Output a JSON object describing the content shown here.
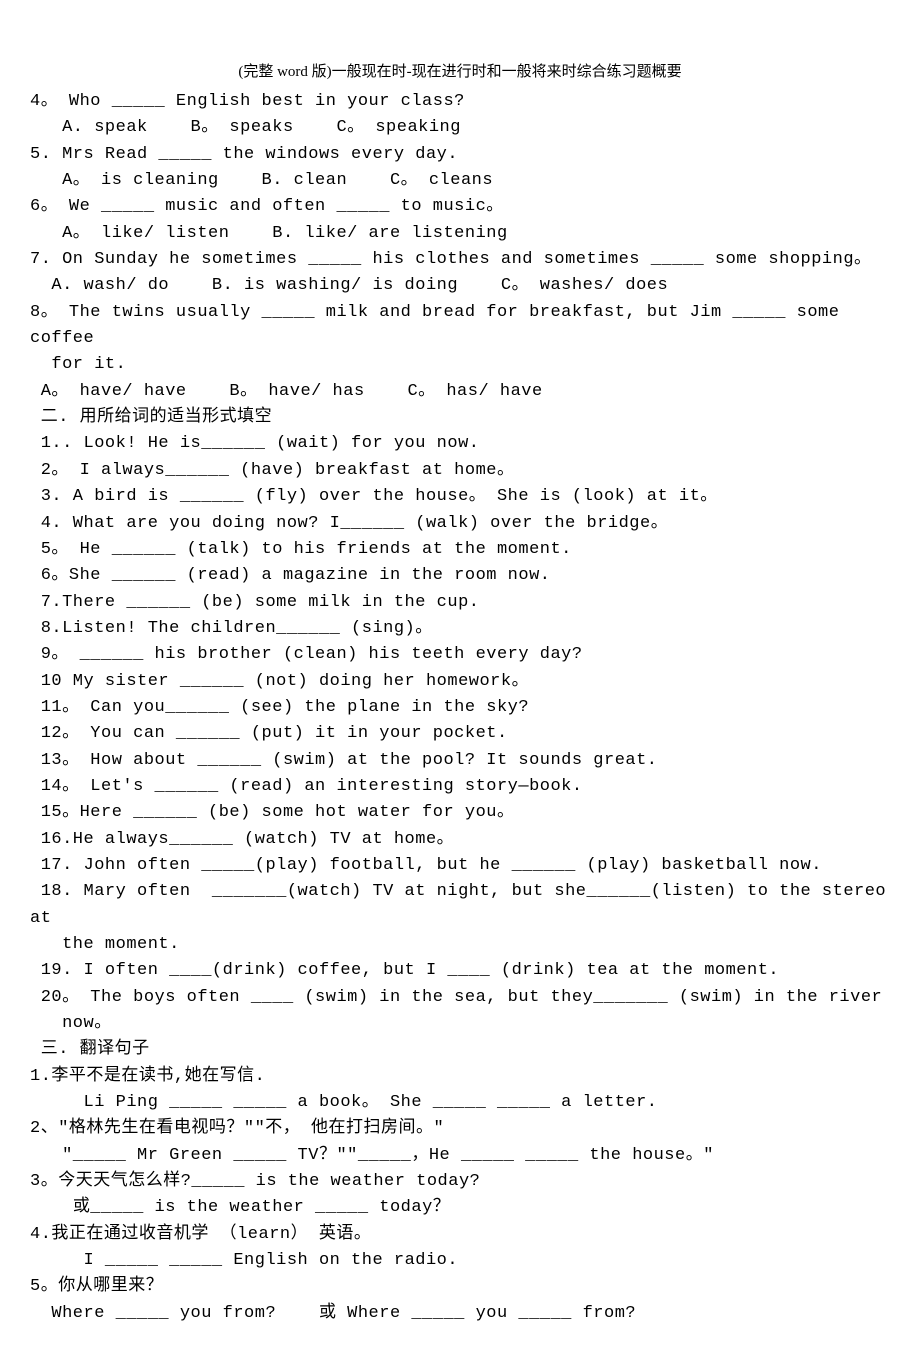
{
  "header": "(完整 word 版)一般现在时-现在进行时和一般将来时综合练习题概要",
  "mc": {
    "q4": {
      "text": "4。 Who _____ English best in your class?",
      "opts": "   A. speak    B。 speaks    C。 speaking"
    },
    "q5": {
      "text": "5. Mrs Read _____ the windows every day.",
      "opts": "   A。 is cleaning    B. clean    C。 cleans"
    },
    "q6": {
      "text": "6。 We _____ music and often _____ to music。",
      "opts": "   A。 like/ listen    B. like/ are listening"
    },
    "q7": {
      "text": "7. On Sunday he sometimes _____ his clothes and sometimes _____ some shopping。",
      "opts": "  A. wash/ do    B. is washing/ is doing    C。 washes/ does"
    },
    "q8": {
      "text": "8。 The twins usually _____ milk and bread for breakfast, but Jim _____ some coffee",
      "cont": "  for it.",
      "opts": " A。 have/ have    B。 have/ has    C。 has/ have"
    }
  },
  "sec2": {
    "title": " 二. 用所给词的适当形式填空",
    "items": [
      " 1.. Look! He is______ (wait) for you now.",
      " 2。 I always______ (have) breakfast at home。",
      " 3. A bird is ______ (fly) over the house。 She is (look) at it。",
      " 4. What are you doing now? I______ (walk) over the bridge。",
      " 5。 He ______ (talk) to his friends at the moment.",
      " 6。She ______ (read) a magazine in the room now.",
      " 7.There ______ (be) some milk in the cup.",
      " 8.Listen! The children______ (sing)。",
      " 9。 ______ his brother (clean) his teeth every day?",
      " 10 My sister ______ (not) doing her homework。",
      " 11。 Can you______ (see) the plane in the sky?",
      " 12。 You can ______ (put) it in your pocket.",
      " 13。 How about ______ (swim) at the pool? It sounds great.",
      " 14。 Let's ______ (read) an interesting story—book.",
      " 15。Here ______ (be) some hot water for you。",
      " 16.He always______ (watch) TV at home。",
      " 17. John often _____(play) football, but he ______ (play) basketball now.",
      " 18. Mary often  _______(watch) TV at night, but she______(listen) to the stereo at",
      "   the moment.",
      " 19. I often ____(drink) coffee, but I ____ (drink) tea at the moment.",
      " 20。 The boys often ____ (swim) in the sea, but they_______ (swim) in the river",
      "   now。"
    ]
  },
  "sec3": {
    "title": " 三. 翻译句子",
    "q1": {
      "zh": "1.李平不是在读书,她在写信.",
      "en_a": "     Li Ping _____ _____ a book。 She _____ _____ a letter."
    },
    "q2": {
      "zh": "2、\"格林先生在看电视吗？\"\"不， 他在打扫房间。\"",
      "en_a": "   \"_____ Mr Green _____ TV？\"\"_____，He _____ _____ the house。\""
    },
    "q3": {
      "zh": "3。今天天气怎么样?_____ is the weather today?",
      "en_a": "    或_____ is the weather _____ today？"
    },
    "q4": {
      "zh": "4.我正在通过收音机学 （learn） 英语。",
      "en_a": "     I _____ _____ English on the radio."
    },
    "q5": {
      "zh": "5。你从哪里来？",
      "en_a": "  Where _____ you from?    或 Where _____ you _____ from?"
    }
  }
}
